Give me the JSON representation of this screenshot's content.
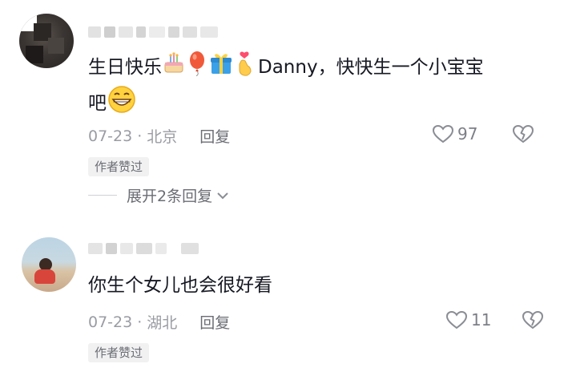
{
  "comments": [
    {
      "text_part1": "生日快乐",
      "text_part2": "Danny，快快生一个小宝宝",
      "text_part3": "吧",
      "date": "07-23",
      "separator": "·",
      "location": "北京",
      "reply_label": "回复",
      "likes": "97",
      "badge": "作者赞过",
      "expand_replies": "展开2条回复",
      "emojis": [
        "cake-icon",
        "balloon-icon",
        "gift-icon",
        "finger-heart-icon",
        "grin-icon"
      ]
    },
    {
      "text": "你生个女儿也会很好看",
      "date": "07-23",
      "separator": "·",
      "location": "湖北",
      "reply_label": "回复",
      "likes": "11",
      "badge": "作者赞过"
    }
  ],
  "colors": {
    "text_primary": "#161823",
    "text_secondary": "#9a9ca3",
    "badge_bg": "#f1f1f2"
  }
}
